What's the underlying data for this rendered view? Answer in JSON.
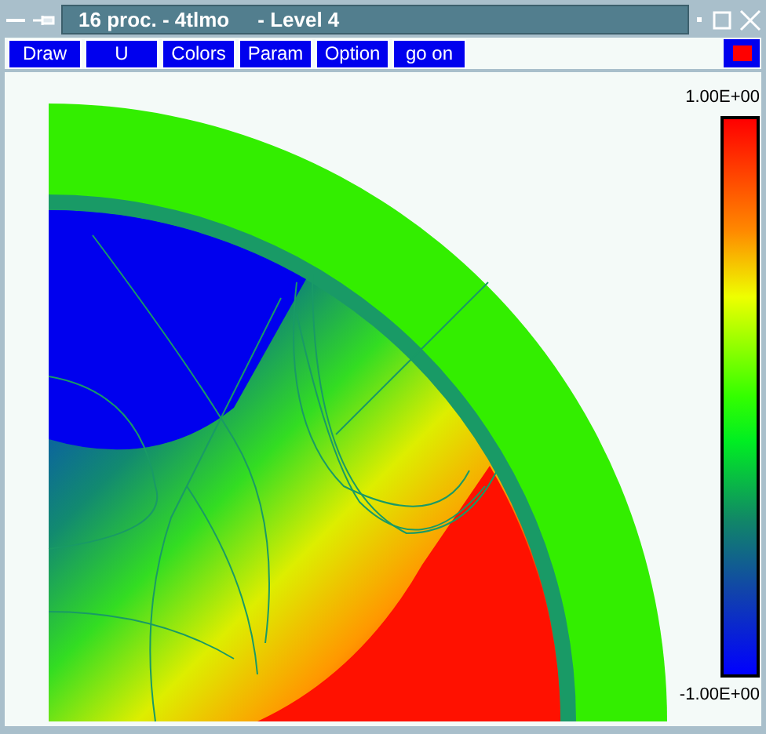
{
  "window": {
    "title": "16 proc. - 4tlmo     - Level 4"
  },
  "menu": [
    "Draw",
    "U",
    "Colors",
    "Param",
    "Option",
    "go on"
  ],
  "colorbar": {
    "max_label": "1.00E+00",
    "min_label": "-1.00E+00"
  }
}
